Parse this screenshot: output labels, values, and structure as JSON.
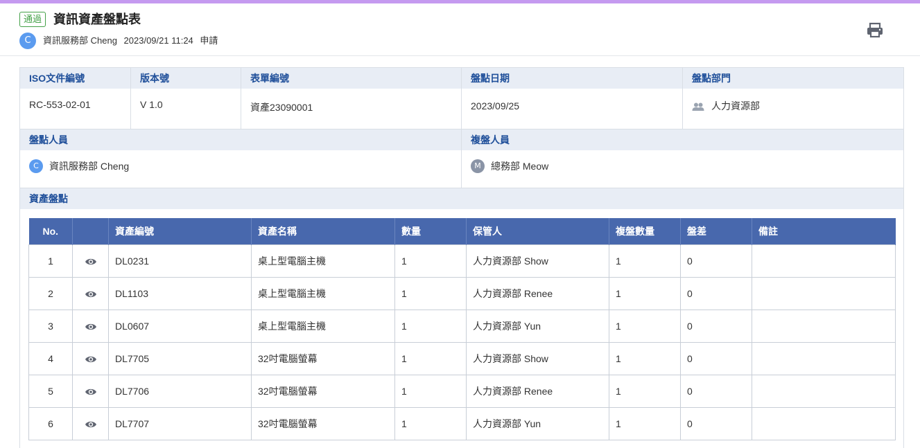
{
  "header": {
    "status_badge": "通過",
    "title": "資訊資產盤點表",
    "applicant_initial": "C",
    "applicant": "資訊服務部 Cheng",
    "datetime": "2023/09/21 11:24",
    "action": "申請",
    "print_icon": "printer-icon"
  },
  "form": {
    "iso_label": "ISO文件編號",
    "iso_value": "RC-553-02-01",
    "version_label": "版本號",
    "version_value": "V 1.0",
    "form_no_label": "表單編號",
    "form_no_value": "資產23090001",
    "date_label": "盤點日期",
    "date_value": "2023/09/25",
    "dept_label": "盤點部門",
    "dept_value": "人力資源部",
    "dept_icon": "group-icon",
    "counter_label": "盤點人員",
    "counter_initial": "C",
    "counter_value": "資訊服務部 Cheng",
    "rechecker_label": "複盤人員",
    "rechecker_initial": "M",
    "rechecker_value": "總務部 Meow",
    "section_label": "資產盤點"
  },
  "table": {
    "headers": [
      "No.",
      "",
      "資產編號",
      "資產名稱",
      "數量",
      "保管人",
      "複盤數量",
      "盤差",
      "備註"
    ],
    "row_icon": "eye-icon",
    "rows": [
      {
        "no": "1",
        "code": "DL0231",
        "name": "桌上型電腦主機",
        "qty": "1",
        "keeper": "人力資源部 Show",
        "recheck": "1",
        "diff": "0",
        "note": ""
      },
      {
        "no": "2",
        "code": "DL1103",
        "name": "桌上型電腦主機",
        "qty": "1",
        "keeper": "人力資源部 Renee",
        "recheck": "1",
        "diff": "0",
        "note": ""
      },
      {
        "no": "3",
        "code": "DL0607",
        "name": "桌上型電腦主機",
        "qty": "1",
        "keeper": "人力資源部 Yun",
        "recheck": "1",
        "diff": "0",
        "note": ""
      },
      {
        "no": "4",
        "code": "DL7705",
        "name": "32吋電腦螢幕",
        "qty": "1",
        "keeper": "人力資源部 Show",
        "recheck": "1",
        "diff": "0",
        "note": ""
      },
      {
        "no": "5",
        "code": "DL7706",
        "name": "32吋電腦螢幕",
        "qty": "1",
        "keeper": "人力資源部 Renee",
        "recheck": "1",
        "diff": "0",
        "note": ""
      },
      {
        "no": "6",
        "code": "DL7707",
        "name": "32吋電腦螢幕",
        "qty": "1",
        "keeper": "人力資源部 Yun",
        "recheck": "1",
        "diff": "0",
        "note": ""
      }
    ]
  },
  "colors": {
    "accent_bar": "#c59af0",
    "label_text": "#1f4f9a",
    "label_bg": "#e8edf5",
    "table_header_bg": "#4868ad",
    "approved_green": "#43a047",
    "avatar_blue": "#5b9bef",
    "avatar_gray": "#8a94a6"
  }
}
